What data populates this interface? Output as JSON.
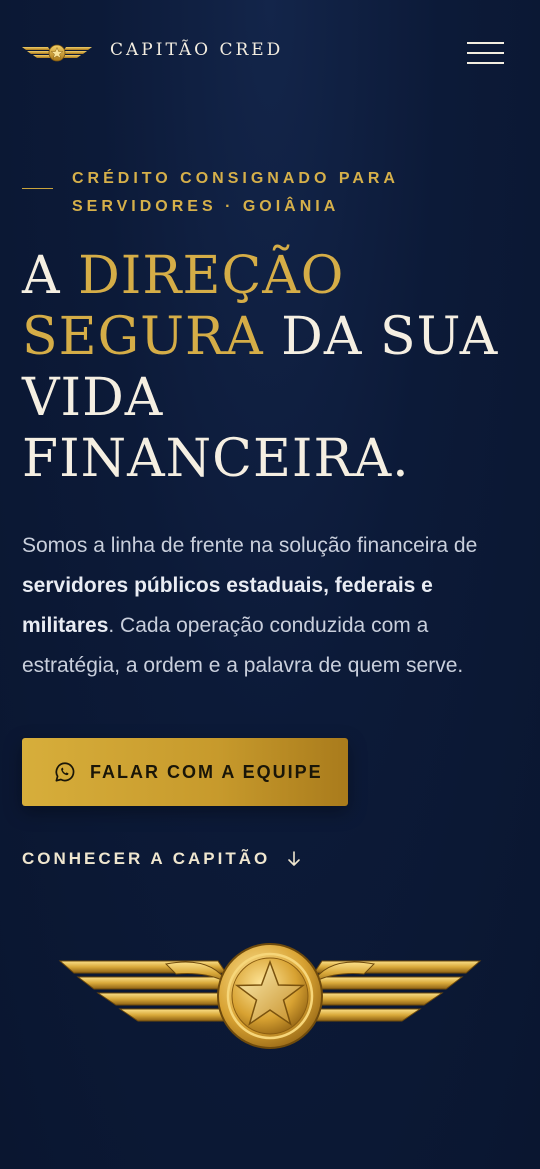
{
  "header": {
    "brand": "CAPITÃO CRED",
    "logo_icon": "winged-star-icon",
    "menu_icon": "hamburger-menu-icon"
  },
  "hero": {
    "eyebrow": "CRÉDITO CONSIGNADO PARA SERVIDORES · GOIÂNIA",
    "headline": {
      "part1": "A ",
      "gold": "DIREÇÃO SEGURA",
      "part2": " DA SUA VIDA FINANCEIRA."
    },
    "lede": {
      "part1": "Somos a linha de frente na solução financeira de ",
      "bold": "servidores públicos estaduais, federais e militares",
      "part2": ". Cada operação conduzida com a estratégia, a ordem e a palavra de quem serve."
    },
    "cta_label": "FALAR COM A EQUIPE",
    "cta_icon": "whatsapp-icon",
    "secondary_label": "CONHECER A CAPITÃO",
    "secondary_icon": "arrow-down-icon",
    "emblem_icon": "winged-star-emblem"
  },
  "colors": {
    "background": "#0c1a38",
    "gold": "#d5ad47",
    "cream": "#f3ede0"
  }
}
